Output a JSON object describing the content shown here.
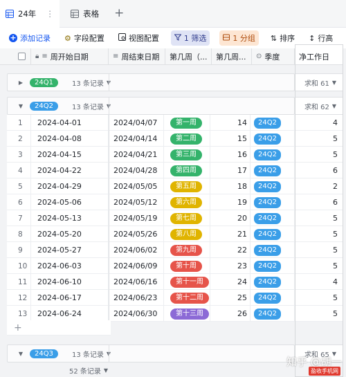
{
  "tabs": [
    {
      "label": "24年",
      "active": true
    },
    {
      "label": "表格",
      "active": false
    }
  ],
  "toolbar": {
    "add_record": "添加记录",
    "field_config": "字段配置",
    "view_config": "视图配置",
    "filter": "1 筛选",
    "group": "1 分组",
    "sort": "排序",
    "row_height": "行高"
  },
  "columns": {
    "start_date": "周开始日期",
    "end_date": "周结束日期",
    "week_name": "第几周（...",
    "week_num": "第几周...",
    "quarter": "季度",
    "workdays": "净工作日"
  },
  "groups": [
    {
      "tag": "24Q1",
      "count": "13 条记录",
      "sum": "求和 61",
      "color": "#34b36b"
    },
    {
      "tag": "24Q2",
      "count": "13 条记录",
      "sum": "求和 62",
      "color": "#3a9ee8"
    },
    {
      "tag": "24Q3",
      "count": "13 条记录",
      "sum": "求和 65",
      "color": "#3a9ee8"
    }
  ],
  "rows": [
    {
      "num": "1",
      "start": "2024-04-01",
      "end": "2024/04/07",
      "week": "第一周",
      "week_color": "#34b36b",
      "wnum": "14",
      "quarter": "24Q2",
      "days": "4"
    },
    {
      "num": "2",
      "start": "2024-04-08",
      "end": "2024/04/14",
      "week": "第二周",
      "week_color": "#34b36b",
      "wnum": "15",
      "quarter": "24Q2",
      "days": "5"
    },
    {
      "num": "3",
      "start": "2024-04-15",
      "end": "2024/04/21",
      "week": "第三周",
      "week_color": "#34b36b",
      "wnum": "16",
      "quarter": "24Q2",
      "days": "5"
    },
    {
      "num": "4",
      "start": "2024-04-22",
      "end": "2024/04/28",
      "week": "第四周",
      "week_color": "#34b36b",
      "wnum": "17",
      "quarter": "24Q2",
      "days": "6"
    },
    {
      "num": "5",
      "start": "2024-04-29",
      "end": "2024/05/05",
      "week": "第五周",
      "week_color": "#e0b400",
      "wnum": "18",
      "quarter": "24Q2",
      "days": "2"
    },
    {
      "num": "6",
      "start": "2024-05-06",
      "end": "2024/05/12",
      "week": "第六周",
      "week_color": "#e0b400",
      "wnum": "19",
      "quarter": "24Q2",
      "days": "6"
    },
    {
      "num": "7",
      "start": "2024-05-13",
      "end": "2024/05/19",
      "week": "第七周",
      "week_color": "#e0b400",
      "wnum": "20",
      "quarter": "24Q2",
      "days": "5"
    },
    {
      "num": "8",
      "start": "2024-05-20",
      "end": "2024/05/26",
      "week": "第八周",
      "week_color": "#e0b400",
      "wnum": "21",
      "quarter": "24Q2",
      "days": "5"
    },
    {
      "num": "9",
      "start": "2024-05-27",
      "end": "2024/06/02",
      "week": "第九周",
      "week_color": "#e6544a",
      "wnum": "22",
      "quarter": "24Q2",
      "days": "5"
    },
    {
      "num": "10",
      "start": "2024-06-03",
      "end": "2024/06/09",
      "week": "第十周",
      "week_color": "#e6544a",
      "wnum": "23",
      "quarter": "24Q2",
      "days": "5"
    },
    {
      "num": "11",
      "start": "2024-06-10",
      "end": "2024/06/16",
      "week": "第十一周",
      "week_color": "#e6544a",
      "wnum": "24",
      "quarter": "24Q2",
      "days": "4"
    },
    {
      "num": "12",
      "start": "2024-06-17",
      "end": "2024/06/23",
      "week": "第十二周",
      "week_color": "#e6544a",
      "wnum": "25",
      "quarter": "24Q2",
      "days": "5"
    },
    {
      "num": "13",
      "start": "2024-06-24",
      "end": "2024/06/30",
      "week": "第十三周",
      "week_color": "#8c6ad6",
      "wnum": "26",
      "quarter": "24Q2",
      "days": "5"
    }
  ],
  "footer": {
    "total": "52 条记录"
  },
  "watermark": {
    "text": "知乎 @胡一",
    "badge": "盈收手机网"
  }
}
